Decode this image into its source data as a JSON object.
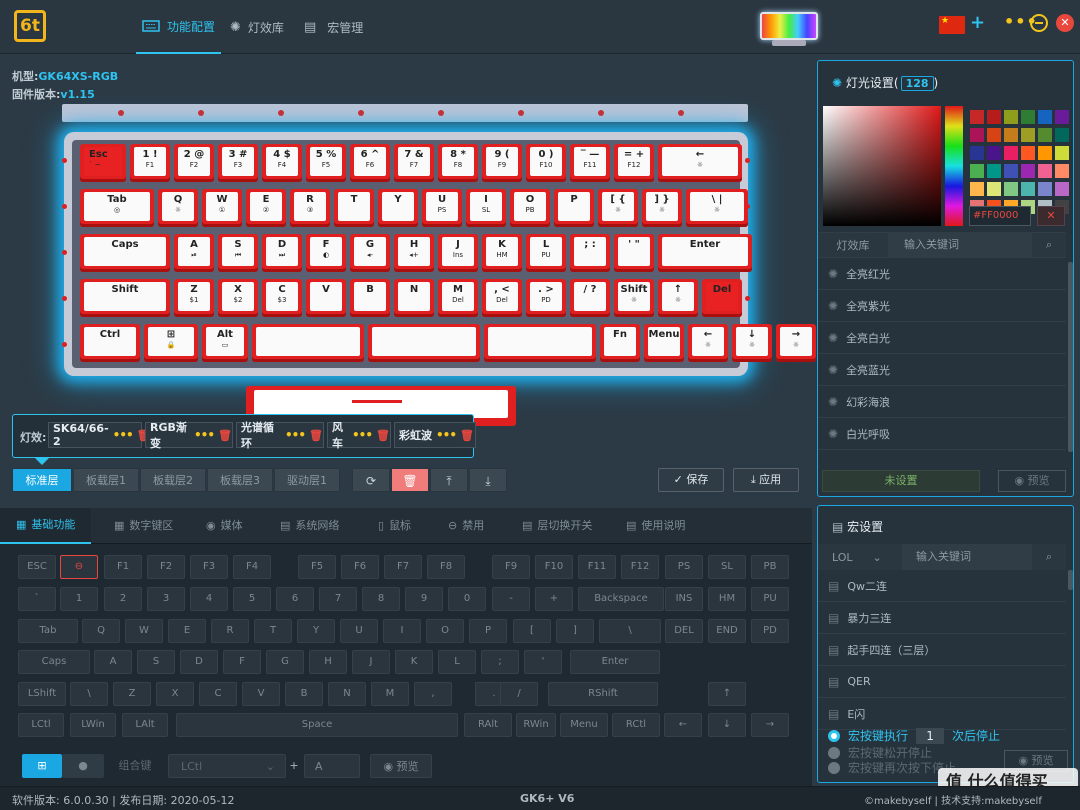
{
  "nav": {
    "tabs": [
      {
        "label": "功能配置"
      },
      {
        "label": "灯效库"
      },
      {
        "label": "宏管理"
      }
    ]
  },
  "device": {
    "model_label": "机型:",
    "model": "GK64XS-RGB",
    "firmware_label": "固件版本:",
    "firmware": "v1.15"
  },
  "keyboard": {
    "rows": [
      [
        {
          "t": "Esc",
          "s": "` ~"
        },
        {
          "t": "1 !",
          "s": "F1"
        },
        {
          "t": "2 @",
          "s": "F2"
        },
        {
          "t": "3 #",
          "s": "F3"
        },
        {
          "t": "4 $",
          "s": "F4"
        },
        {
          "t": "5 %",
          "s": "F5"
        },
        {
          "t": "6 ^",
          "s": "F6"
        },
        {
          "t": "7 &",
          "s": "F7"
        },
        {
          "t": "8 *",
          "s": "F8"
        },
        {
          "t": "9 (",
          "s": "F9"
        },
        {
          "t": "0 )",
          "s": "F10"
        },
        {
          "t": "‾ —",
          "s": "F11"
        },
        {
          "t": "= +",
          "s": "F12"
        },
        {
          "t": "←",
          "s": "☼"
        }
      ],
      [
        {
          "t": "Tab",
          "s": "◎"
        },
        {
          "t": "Q",
          "s": "☼"
        },
        {
          "t": "W",
          "s": "①"
        },
        {
          "t": "E",
          "s": "②"
        },
        {
          "t": "R",
          "s": "③"
        },
        {
          "t": "T",
          "s": ""
        },
        {
          "t": "Y",
          "s": ""
        },
        {
          "t": "U",
          "s": "PS"
        },
        {
          "t": "I",
          "s": "SL"
        },
        {
          "t": "O",
          "s": "PB"
        },
        {
          "t": "P",
          "s": ""
        },
        {
          "t": "[ {",
          "s": "☼"
        },
        {
          "t": "] }",
          "s": "☼"
        },
        {
          "t": "\\ |",
          "s": "☼"
        }
      ],
      [
        {
          "t": "Caps",
          "s": ""
        },
        {
          "t": "A",
          "s": "⏯"
        },
        {
          "t": "S",
          "s": "⏮"
        },
        {
          "t": "D",
          "s": "⏭"
        },
        {
          "t": "F",
          "s": "◐"
        },
        {
          "t": "G",
          "s": "◂-"
        },
        {
          "t": "H",
          "s": "◂+"
        },
        {
          "t": "J",
          "s": "Ins"
        },
        {
          "t": "K",
          "s": "HM"
        },
        {
          "t": "L",
          "s": "PU"
        },
        {
          "t": "; :",
          "s": ""
        },
        {
          "t": "' \"",
          "s": ""
        },
        {
          "t": "Enter",
          "s": ""
        }
      ],
      [
        {
          "t": "Shift",
          "s": ""
        },
        {
          "t": "Z",
          "s": "$1"
        },
        {
          "t": "X",
          "s": "$2"
        },
        {
          "t": "C",
          "s": "$3"
        },
        {
          "t": "V",
          "s": ""
        },
        {
          "t": "B",
          "s": ""
        },
        {
          "t": "N",
          "s": ""
        },
        {
          "t": "M",
          "s": "Del"
        },
        {
          "t": ", <",
          "s": "Del"
        },
        {
          "t": ". >",
          "s": "PD"
        },
        {
          "t": "/ ?",
          "s": ""
        },
        {
          "t": "Shift",
          "s": "☼"
        },
        {
          "t": "↑",
          "s": "☼"
        },
        {
          "t": "Del",
          "s": ""
        }
      ],
      [
        {
          "t": "Ctrl",
          "s": ""
        },
        {
          "t": "⊞",
          "s": "🔒"
        },
        {
          "t": "Alt",
          "s": "▭"
        },
        {
          "t": "",
          "s": ""
        },
        {
          "t": "",
          "s": ""
        },
        {
          "t": "",
          "s": ""
        },
        {
          "t": "Fn",
          "s": ""
        },
        {
          "t": "Menu",
          "s": ""
        },
        {
          "t": "←",
          "s": "☼"
        },
        {
          "t": "↓",
          "s": "☼"
        },
        {
          "t": "→",
          "s": "☼"
        }
      ]
    ]
  },
  "effects": {
    "label": "灯效:",
    "items": [
      "SK64/66-2",
      "RGB渐变",
      "光谱循环",
      "风车",
      "彩虹波"
    ]
  },
  "layers": [
    "标准层",
    "板载层1",
    "板载层2",
    "板载层3",
    "驱动层1"
  ],
  "actions": {
    "save": "保存",
    "apply": "应用"
  },
  "functabs": [
    "基础功能",
    "数字键区",
    "媒体",
    "系统网络",
    "鼠标",
    "禁用",
    "层切换开关",
    "使用说明"
  ],
  "vkeys": [
    [
      "ESC",
      "⊖",
      "F1",
      "F2",
      "F3",
      "F4",
      "F5",
      "F6",
      "F7",
      "F8",
      "F9",
      "F10",
      "F11",
      "F12",
      "PS",
      "SL",
      "PB"
    ],
    [
      "`",
      "1",
      "2",
      "3",
      "4",
      "5",
      "6",
      "7",
      "8",
      "9",
      "0",
      "-",
      "+",
      "Backspace",
      "INS",
      "HM",
      "PU"
    ],
    [
      "Tab",
      "Q",
      "W",
      "E",
      "R",
      "T",
      "Y",
      "U",
      "I",
      "O",
      "P",
      "[",
      "]",
      "\\",
      "DEL",
      "END",
      "PD"
    ],
    [
      "Caps",
      "A",
      "S",
      "D",
      "F",
      "G",
      "H",
      "J",
      "K",
      "L",
      ";",
      "'",
      "Enter"
    ],
    [
      "LShift",
      "\\",
      "Z",
      "X",
      "C",
      "V",
      "B",
      "N",
      "M",
      ",",
      ".",
      "/",
      "RShift",
      "↑"
    ],
    [
      "LCtl",
      "LWin",
      "LAlt",
      "Space",
      "RAlt",
      "RWin",
      "Menu",
      "RCtl",
      "←",
      "↓",
      "→"
    ]
  ],
  "combo": {
    "label": "组合键",
    "select": "LCtl",
    "plus": "+",
    "key": "A",
    "preview": "预览"
  },
  "light": {
    "title": "灯光设置(",
    "count": "128",
    "title_end": ")",
    "hex": "#FF0000",
    "x": "✕",
    "tab_lib": "灯效库",
    "search_placeholder": "输入关键词",
    "list": [
      "全亮红光",
      "全亮紫光",
      "全亮白光",
      "全亮蓝光",
      "幻彩海浪",
      "白光呼吸"
    ],
    "unset": "未设置",
    "preview": "预览",
    "swatches": [
      "#c62828",
      "#b71c1c",
      "#8e9e1c",
      "#2e7d32",
      "#1565c0",
      "#6a1b9a",
      "#ad1457",
      "#d84315",
      "#c57d1c",
      "#9e9d24",
      "#558b2f",
      "#00695c",
      "#283593",
      "#4a148c",
      "#e91e63",
      "#ff5722",
      "#ff9800",
      "#cddc39",
      "#4caf50",
      "#009688",
      "#3f51b5",
      "#9c27b0",
      "#f06292",
      "#ff8a65",
      "#ffb74d",
      "#dce775",
      "#81c784",
      "#4db6ac",
      "#7986cb",
      "#ba68c8",
      "#e57373",
      "#f4511e",
      "#ffa726",
      "#aed581",
      "#b0bec5",
      "#424242"
    ]
  },
  "macro": {
    "title": "宏设置",
    "group": "LOL",
    "search_placeholder": "输入关键词",
    "list": [
      "Qw二连",
      "暴力三连",
      "起手四连（三层）",
      "QER",
      "E闪"
    ],
    "opt1": "宏按键执行",
    "count": "1",
    "opt1_end": "次后停止",
    "opt2": "宏按键松开停止",
    "opt3": "宏按键再次按下停止",
    "preview": "预览"
  },
  "status": {
    "left": "软件版本: 6.0.0.30 | 发布日期: 2020-05-12",
    "center": "GK6+ V6",
    "right": "©makebyself | 技术支持:makebyself"
  },
  "watermark": "值 什么值得买"
}
